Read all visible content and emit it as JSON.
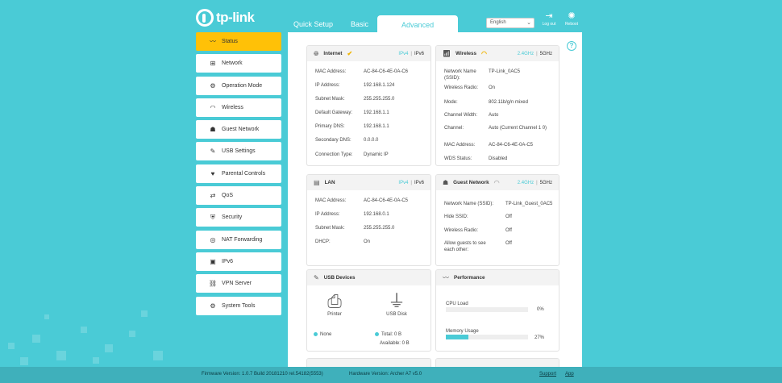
{
  "brand": {
    "logo_text": "tp-link"
  },
  "tabs": [
    {
      "label": "Quick Setup"
    },
    {
      "label": "Basic"
    },
    {
      "label": "Advanced"
    }
  ],
  "topbar": {
    "language": "English",
    "logout": "Log out",
    "reboot": "Reboot"
  },
  "sidebar": {
    "items": [
      {
        "label": "Status"
      },
      {
        "label": "Network"
      },
      {
        "label": "Operation Mode"
      },
      {
        "label": "Wireless"
      },
      {
        "label": "Guest Network"
      },
      {
        "label": "USB Settings"
      },
      {
        "label": "Parental Controls"
      },
      {
        "label": "QoS"
      },
      {
        "label": "Security"
      },
      {
        "label": "NAT Forwarding"
      },
      {
        "label": "IPv6"
      },
      {
        "label": "VPN Server"
      },
      {
        "label": "System Tools"
      }
    ]
  },
  "internet": {
    "title": "Internet",
    "ipv4": "IPv4",
    "ipv6": "IPv6",
    "rows": [
      {
        "label": "MAC Address:",
        "value": "AC-84-C6-4E-0A-C6"
      },
      {
        "label": "IP Address:",
        "value": "192.168.1.124"
      },
      {
        "label": "Subnet Mask:",
        "value": "255.255.255.0"
      },
      {
        "label": "Default Gateway:",
        "value": "192.168.1.1"
      },
      {
        "label": "Primary DNS:",
        "value": "192.168.1.1"
      },
      {
        "label": "Secondary DNS:",
        "value": "0.0.0.0"
      },
      {
        "label": "Connection Type:",
        "value": "Dynamic IP"
      }
    ]
  },
  "wireless": {
    "title": "Wireless",
    "band24": "2.4GHz",
    "band5": "5GHz",
    "rows": [
      {
        "label": "Network Name (SSID):",
        "value": "TP-Link_0AC5"
      },
      {
        "label": "Wireless Radio:",
        "value": "On"
      },
      {
        "label": "Mode:",
        "value": "802.11b/g/n mixed"
      },
      {
        "label": "Channel Width:",
        "value": "Auto"
      },
      {
        "label": "Channel:",
        "value": "Auto (Current Channel 1 0)"
      },
      {
        "label": "MAC Address:",
        "value": "AC-84-C6-4E-0A-C5"
      },
      {
        "label": "WDS Status:",
        "value": "Disabled"
      }
    ]
  },
  "lan": {
    "title": "LAN",
    "ipv4": "IPv4",
    "ipv6": "IPv6",
    "rows": [
      {
        "label": "MAC Address:",
        "value": "AC-84-C6-4E-0A-C5"
      },
      {
        "label": "IP Address:",
        "value": "192.168.0.1"
      },
      {
        "label": "Subnet Mask:",
        "value": "255.255.255.0"
      },
      {
        "label": "DHCP:",
        "value": "On"
      }
    ]
  },
  "guest": {
    "title": "Guest Network",
    "band24": "2.4GHz",
    "band5": "5GHz",
    "rows": [
      {
        "label": "Network Name (SSID):",
        "value": "TP-Link_Guest_0AC5"
      },
      {
        "label": "Hide SSID:",
        "value": "Off"
      },
      {
        "label": "Wireless Radio:",
        "value": "Off"
      },
      {
        "label": "Allow guests to see each other:",
        "value": "Off"
      }
    ]
  },
  "usb": {
    "title": "USB Devices",
    "printer_label": "Printer",
    "printer_status": "None",
    "disk_label": "USB Disk",
    "total_label": "Total:",
    "total_value": "0 B",
    "available_label": "Available:",
    "available_value": "0 B"
  },
  "performance": {
    "title": "Performance",
    "cpu_label": "CPU Load",
    "cpu_value": "0%",
    "cpu_fraction": 0,
    "mem_label": "Memory Usage",
    "mem_value": "27%",
    "mem_fraction": 0.27
  },
  "footer": {
    "firmware": "Firmware Version: 1.0.7 Build 20181210 rel.54182(5553)",
    "hardware": "Hardware Version: Archer A7 v5.0",
    "support": "Support",
    "app": "App"
  },
  "colors": {
    "accent": "#4acbd6",
    "active_item": "#ffc107",
    "background": "#4acbd6"
  }
}
